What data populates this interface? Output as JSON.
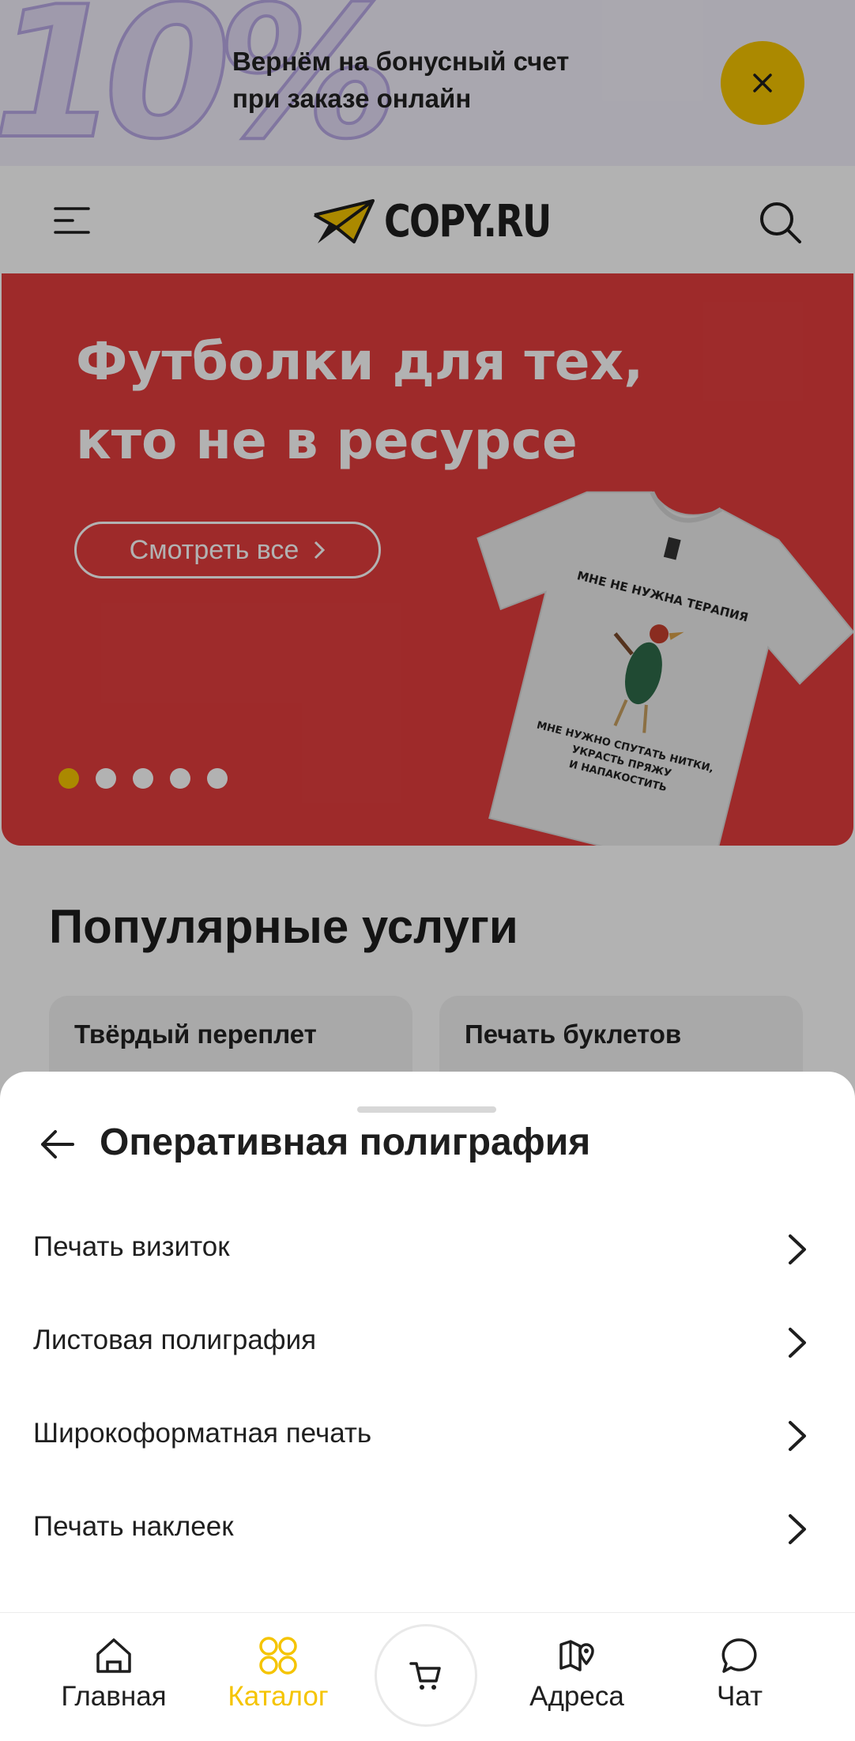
{
  "promo": {
    "big_text": "10%",
    "line1": "Вернём на бонусный счет",
    "line2": "при заказе онлайн"
  },
  "header": {
    "logo_text": "COPY.RU"
  },
  "banner": {
    "title_line1": "Футболки для тех,",
    "title_line2": "кто не в ресурсе",
    "button_label": "Смотреть все",
    "tshirt_top": "МНЕ НЕ НУЖНА ТЕРАПИЯ",
    "tshirt_bottom1": "МНЕ НУЖНО СПУТАТЬ НИТКИ,",
    "tshirt_bottom2": "УКРАСТЬ ПРЯЖУ",
    "tshirt_bottom3": "И НАПАКОСТИТЬ",
    "slides_total": 5,
    "slide_active": 1
  },
  "popular": {
    "title": "Популярные услуги",
    "cards": [
      {
        "label": "Твёрдый переплет"
      },
      {
        "label": "Печать буклетов"
      }
    ]
  },
  "sheet": {
    "title": "Оперативная полиграфия",
    "items": [
      {
        "label": "Печать визиток"
      },
      {
        "label": "Листовая полиграфия"
      },
      {
        "label": "Широкоформатная печать"
      },
      {
        "label": "Печать наклеек"
      }
    ]
  },
  "nav": {
    "items": [
      {
        "label": "Главная",
        "icon": "home-icon"
      },
      {
        "label": "Каталог",
        "icon": "catalog-icon",
        "active": true
      },
      {
        "label": "",
        "icon": "cart-icon"
      },
      {
        "label": "Адреса",
        "icon": "map-icon"
      },
      {
        "label": "Чат",
        "icon": "chat-icon"
      }
    ]
  },
  "colors": {
    "accent": "#f5c400",
    "banner_bg": "#e33d3d",
    "overlay": "rgba(0,0,0,0.30)"
  }
}
